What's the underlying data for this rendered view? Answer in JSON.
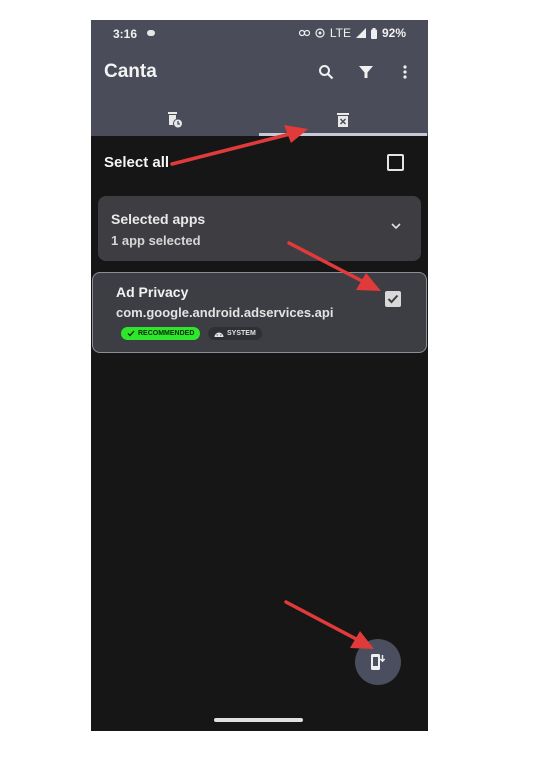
{
  "status_bar": {
    "time": "3:16",
    "network": "LTE",
    "battery": "92%"
  },
  "app_bar": {
    "title": "Canta",
    "icons": [
      "search-icon",
      "filter-icon",
      "more-vert-icon"
    ]
  },
  "tabs": [
    {
      "icon": "trash-clock-icon",
      "active": false
    },
    {
      "icon": "trash-x-icon",
      "active": true
    }
  ],
  "select_all": {
    "label": "Select all",
    "checked": false
  },
  "selected_apps": {
    "title": "Selected apps",
    "subtitle": "1 app selected"
  },
  "apps": [
    {
      "name": "Ad Privacy",
      "package": "com.google.android.adservices.api",
      "badges": {
        "recommended": "RECOMMENDED",
        "system": "SYSTEM"
      },
      "checked": true
    }
  ],
  "colors": {
    "header": "#4a4c59",
    "background": "#161616",
    "card": "#3e3e42",
    "recommended_badge": "#2ee62a",
    "annotation_arrow": "#e03a3a"
  }
}
